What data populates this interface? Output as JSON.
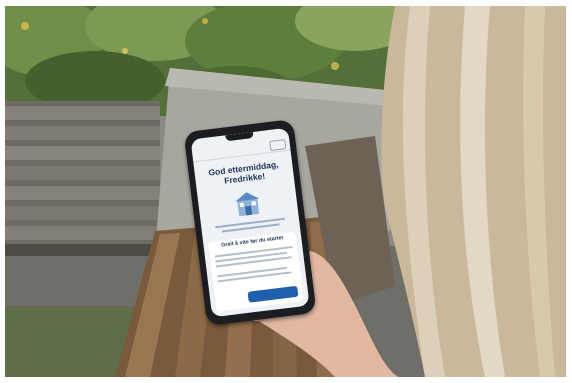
{
  "phone": {
    "greeting": "God ettermiddag, Fredrikke!",
    "card_title": "Greit å vite før du starter",
    "colors": {
      "screen_bg": "#eef1f5",
      "accent": "#1f5fae",
      "heading": "#1d3557"
    }
  }
}
